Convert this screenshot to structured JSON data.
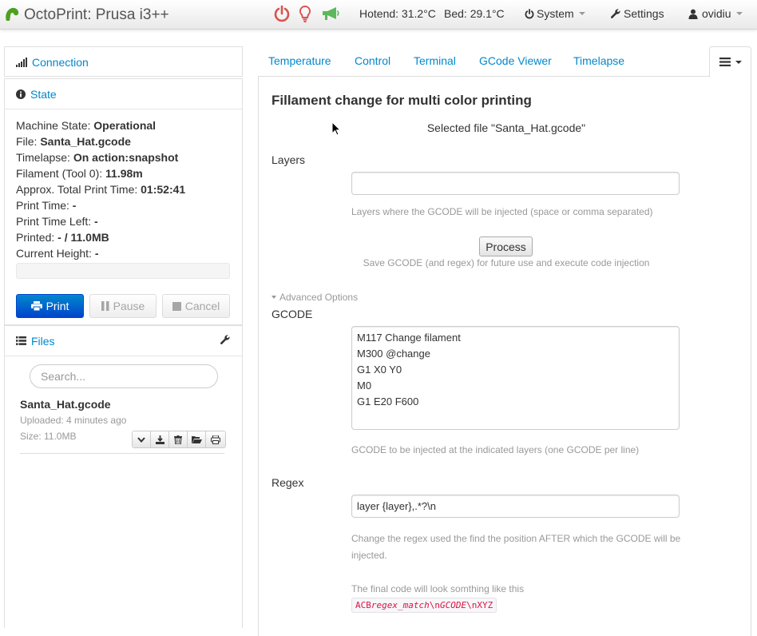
{
  "navbar": {
    "title": "OctoPrint: Prusa i3++",
    "hotend": "Hotend: 31.2°C",
    "bed": "Bed: 29.1°C",
    "system": "System",
    "settings": "Settings",
    "user": "ovidiu",
    "colors": {
      "power": "#d9534f",
      "bulb": "#d9534f",
      "megaphone": "#5cb85c",
      "brand": "#4ca022"
    }
  },
  "sidebar": {
    "connection": {
      "title": "Connection"
    },
    "state": {
      "title": "State",
      "lines": [
        {
          "label": "Machine State: ",
          "value": "Operational"
        },
        {
          "label": "File: ",
          "value": "Santa_Hat.gcode"
        },
        {
          "label": "Timelapse: ",
          "value": "On action:snapshot"
        },
        {
          "label": "Filament (Tool 0): ",
          "value": "11.98m"
        },
        {
          "label": "Approx. Total Print Time: ",
          "value": "01:52:41"
        },
        {
          "label": "Print Time: ",
          "value": "-"
        },
        {
          "label": "Print Time Left: ",
          "value": "-"
        },
        {
          "label": "Printed: ",
          "value": "- / 11.0MB"
        },
        {
          "label": "Current Height: ",
          "value": "-"
        }
      ],
      "buttons": {
        "print": "Print",
        "pause": "Pause",
        "cancel": "Cancel"
      }
    },
    "files": {
      "title": "Files",
      "search_placeholder": "Search...",
      "items": [
        {
          "name": "Santa_Hat.gcode",
          "uploaded": "Uploaded: 4 minutes ago",
          "size": "Size: 11.0MB"
        }
      ]
    }
  },
  "tabs": [
    "Temperature",
    "Control",
    "Terminal",
    "GCode Viewer",
    "Timelapse"
  ],
  "main": {
    "heading": "Fillament change for multi color printing",
    "selected_file": "Selected file \"Santa_Hat.gcode\"",
    "layers": {
      "label": "Layers",
      "value": "",
      "help": "Layers where the GCODE will be injected (space or comma separated)"
    },
    "process": {
      "label": "Process",
      "help": "Save GCODE (and regex) for future use and execute code injection"
    },
    "advanced_label": "Advanced Options",
    "gcode": {
      "label": "GCODE",
      "value": "M117 Change filament\nM300 @change\nG1 X0 Y0\nM0\nG1 E20 F600",
      "help": "GCODE to be injected at the indicated layers (one GCODE per line)"
    },
    "regex": {
      "label": "Regex",
      "value": "layer {layer},.*?\\n",
      "help1": "Change the regex used the find the position AFTER which the GCODE will be",
      "help2": "injected.",
      "final_text": "The final code will look somthing like this",
      "code_prefix": "ACB",
      "code_match": "regex_match",
      "code_nl1": "\\n",
      "code_gcode": "GCODE",
      "code_suffix": "\\nXYZ"
    }
  }
}
